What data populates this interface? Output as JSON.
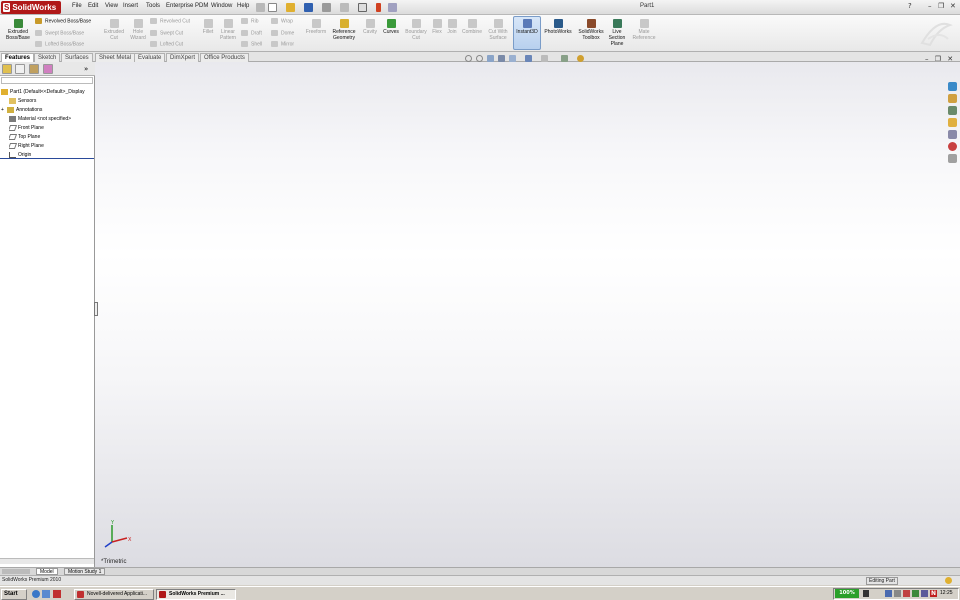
{
  "app": {
    "logo_text": "SolidWorks",
    "document_title": "Part1"
  },
  "menu": [
    "File",
    "Edit",
    "View",
    "Insert",
    "Tools",
    "Enterprise PDM",
    "Window",
    "Help"
  ],
  "window_controls": {
    "help": "?",
    "minimize": "–",
    "restore": "❐",
    "close": "✕"
  },
  "ribbon": {
    "extruded_boss": "Extruded Boss/Base",
    "revolved_boss": "Revolved Boss/Base",
    "swept_boss": "Swept Boss/Base",
    "lofted_boss": "Lofted Boss/Base",
    "extruded_cut": "Extruded Cut",
    "hole_wizard": "Hole Wizard",
    "revolved_cut": "Revolved Cut",
    "swept_cut": "Swept Cut",
    "lofted_cut": "Lofted Cut",
    "fillet": "Fillet",
    "linear_pattern": "Linear Pattern",
    "rib": "Rib",
    "draft": "Draft",
    "shell": "Shell",
    "wrap": "Wrap",
    "dome": "Dome",
    "mirror": "Mirror",
    "freeform": "Freeform",
    "reference_geometry": "Reference Geometry",
    "cavity": "Cavity",
    "curves": "Curves",
    "boundary_cut": "Boundary Cut",
    "flex": "Flex",
    "join": "Join",
    "combine": "Combine",
    "cut_with_surface": "Cut With Surface",
    "instant3d": "Instant3D",
    "photoworks": "PhotoWorks",
    "toolbox": "SolidWorks Toolbox",
    "live_section": "Live Section Plane",
    "mate_reference": "Mate Reference"
  },
  "command_tabs": [
    "Features",
    "Sketch",
    "Surfaces",
    "Sheet Metal",
    "Evaluate",
    "DimXpert",
    "Office Products"
  ],
  "feature_tree": {
    "root": "Part1  (Default<<Default>_Display",
    "items": [
      "Sensors",
      "Annotations",
      "Material <not specified>",
      "Front Plane",
      "Top Plane",
      "Right Plane",
      "Origin"
    ]
  },
  "view": {
    "orientation_label": "*Trimetric",
    "collapse_glyph": "»"
  },
  "bottom_tabs": [
    "Model",
    "Motion Study 1"
  ],
  "status": {
    "left": "SolidWorks Premium 2010",
    "right": "Editing Part"
  },
  "taskbar": {
    "start": "Start",
    "tasks": [
      "Novell-delivered Applicati...",
      "SolidWorks Premium ..."
    ],
    "zoom": "100%",
    "clock": "12:25"
  },
  "colors": {
    "accent_red": "#b01818",
    "viewport_top": "#e9e9ee",
    "viewport_bottom": "#dcdce2",
    "instant3d_active": "#b8d0ee"
  }
}
